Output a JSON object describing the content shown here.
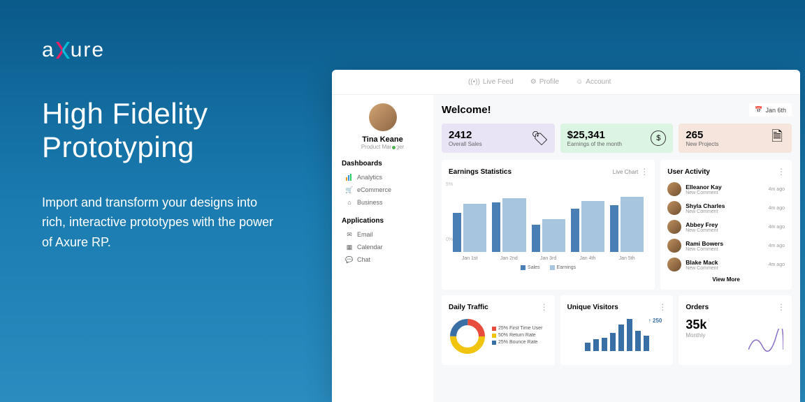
{
  "hero": {
    "brand_pre": "a",
    "brand_post": "ure",
    "headline": "High Fidelity Prototyping",
    "body": "Import and transform your designs into rich, interactive prototypes with the power of Axure RP."
  },
  "topnav": {
    "live_feed": "Live Feed",
    "profile": "Profile",
    "account": "Account"
  },
  "user": {
    "name": "Tina Keane",
    "role": "Product Manager"
  },
  "sidebar": {
    "dash_head": "Dashboards",
    "apps_head": "Applications",
    "dash": [
      {
        "label": "Analytics"
      },
      {
        "label": "eCommerce"
      },
      {
        "label": "Business"
      }
    ],
    "apps": [
      {
        "label": "Email"
      },
      {
        "label": "Calendar"
      },
      {
        "label": "Chat"
      }
    ]
  },
  "welcome": "Welcome!",
  "date_picker": "Jan 6th",
  "stats": {
    "a_val": "2412",
    "a_lab": "Overall Sales",
    "b_val": "$25,341",
    "b_lab": "Earnings of the month",
    "c_val": "265",
    "c_lab": "New Projects"
  },
  "earnings": {
    "title": "Earnings Statistics",
    "live_chart": "Live Chart"
  },
  "activity": {
    "title": "User Activity",
    "items": [
      {
        "name": "Elleanor Kay",
        "sub": "New Comment",
        "time": "4m ago"
      },
      {
        "name": "Shyla Charles",
        "sub": "New Comment",
        "time": "4m ago"
      },
      {
        "name": "Abbey Frey",
        "sub": "New Comment",
        "time": "4m ago"
      },
      {
        "name": "Rami Bowers",
        "sub": "New Comment",
        "time": "4m ago"
      },
      {
        "name": "Blake Mack",
        "sub": "New Comment",
        "time": "4m ago"
      }
    ],
    "view_more": "View More"
  },
  "traffic": {
    "title": "Daily Traffic",
    "legend": [
      {
        "label": "25% First Time User",
        "color": "#e74c3c"
      },
      {
        "label": "50% Return Rate",
        "color": "#f1c40f"
      },
      {
        "label": "25% Bounce Rate",
        "color": "#3a6fa5"
      }
    ]
  },
  "uv": {
    "title": "Unique Visitors",
    "badge": "↑ 250"
  },
  "orders": {
    "title": "Orders",
    "val": "35k",
    "lab": "Monthly"
  },
  "chart_data": {
    "type": "bar",
    "title": "Earnings Statistics",
    "categories": [
      "Jan 1st",
      "Jan 2nd",
      "Jan 3rd",
      "Jan 4th",
      "Jan 5th"
    ],
    "series": [
      {
        "name": "Sales",
        "color": "#4a7fb5",
        "values": [
          65,
          82,
          45,
          72,
          78
        ]
      },
      {
        "name": "Earnings",
        "color": "#a8c5e0",
        "values": [
          80,
          90,
          55,
          85,
          92
        ]
      }
    ],
    "ylabel": "",
    "ylim": [
      0,
      100
    ],
    "yticks": [
      "0%",
      "5%"
    ],
    "legend_labels": [
      "Sales",
      "Earnings"
    ],
    "uv_bars": [
      25,
      35,
      40,
      55,
      80,
      95,
      60,
      45
    ],
    "donut": [
      {
        "label": "First Time User",
        "value": 25,
        "color": "#e74c3c"
      },
      {
        "label": "Return Rate",
        "value": 50,
        "color": "#f1c40f"
      },
      {
        "label": "Bounce Rate",
        "value": 25,
        "color": "#3a6fa5"
      }
    ]
  }
}
